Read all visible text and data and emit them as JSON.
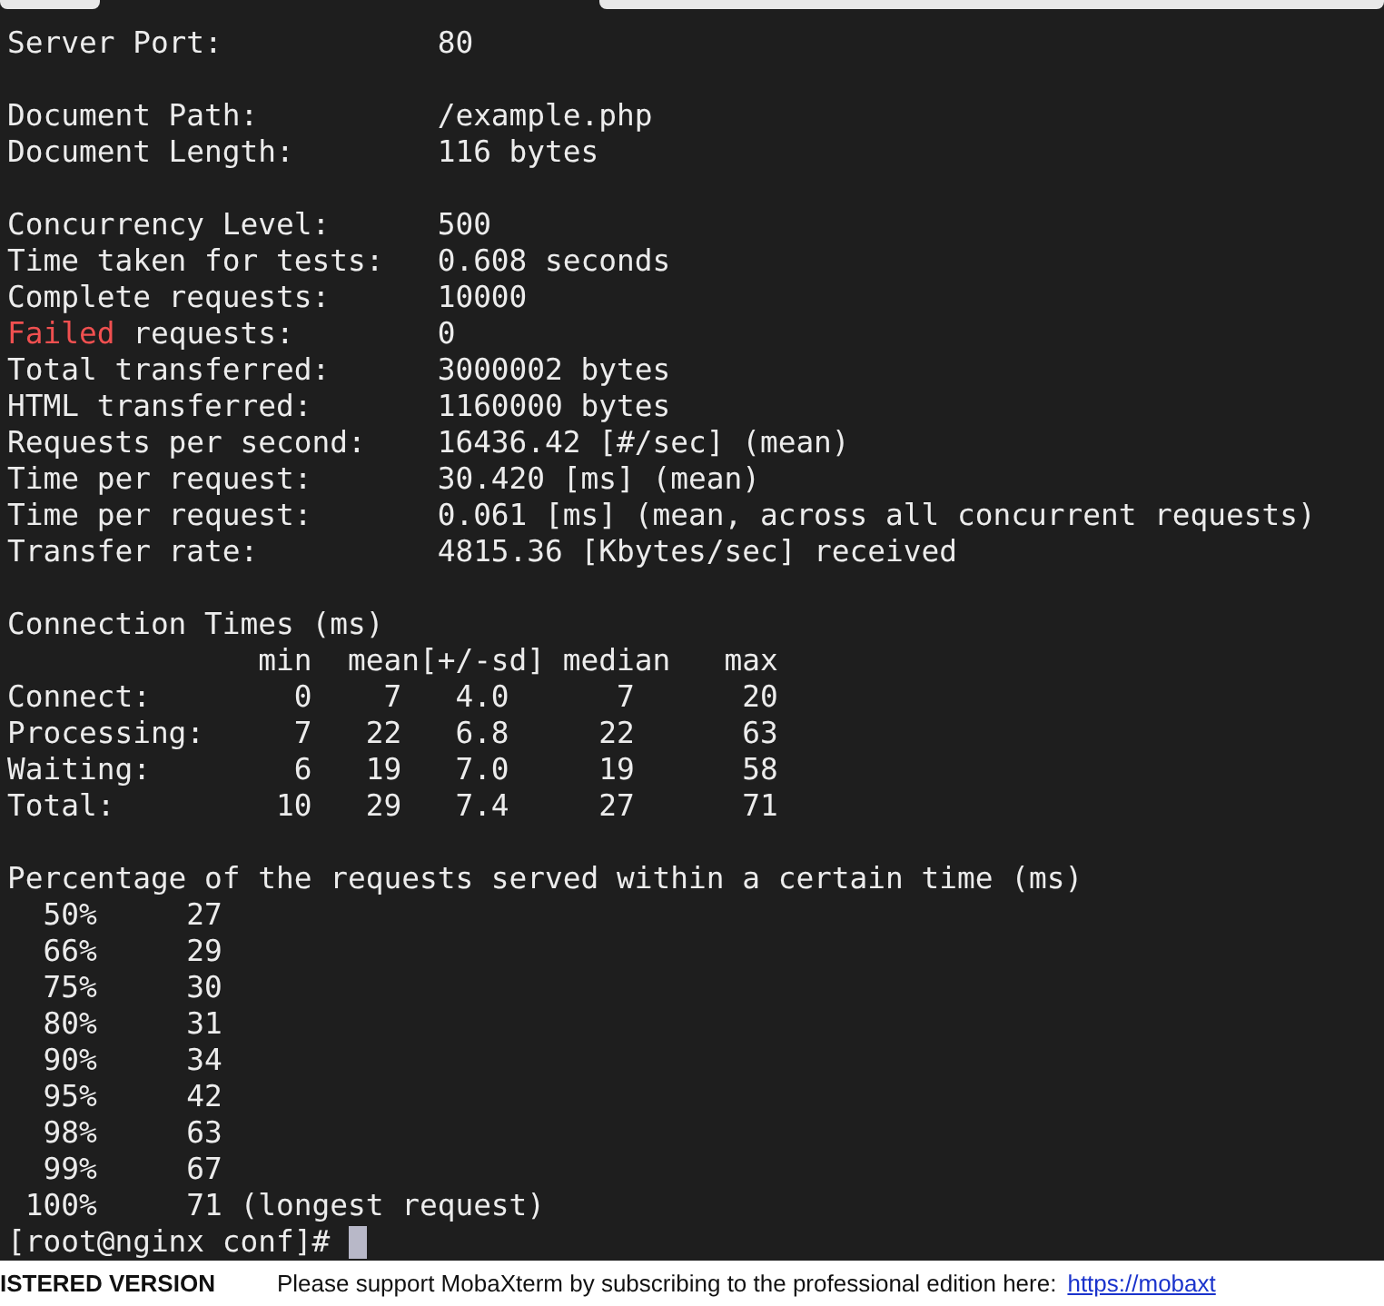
{
  "tabs": [
    {
      "selected": false
    },
    {
      "selected": false
    }
  ],
  "terminal": {
    "lines": [
      {
        "kind": "text",
        "segments": [
          {
            "text": "Server Port:            80"
          }
        ]
      },
      {
        "kind": "blank"
      },
      {
        "kind": "text",
        "segments": [
          {
            "text": "Document Path:          /example.php"
          }
        ]
      },
      {
        "kind": "text",
        "segments": [
          {
            "text": "Document Length:        116 bytes"
          }
        ]
      },
      {
        "kind": "blank"
      },
      {
        "kind": "text",
        "segments": [
          {
            "text": "Concurrency Level:      500"
          }
        ]
      },
      {
        "kind": "text",
        "segments": [
          {
            "text": "Time taken for tests:   0.608 seconds"
          }
        ]
      },
      {
        "kind": "text",
        "segments": [
          {
            "text": "Complete requests:      10000"
          }
        ]
      },
      {
        "kind": "text",
        "segments": [
          {
            "text": "Failed",
            "kind": "error"
          },
          {
            "text": " requests:        0"
          }
        ]
      },
      {
        "kind": "text",
        "segments": [
          {
            "text": "Total transferred:      3000002 bytes"
          }
        ]
      },
      {
        "kind": "text",
        "segments": [
          {
            "text": "HTML transferred:       1160000 bytes"
          }
        ]
      },
      {
        "kind": "text",
        "segments": [
          {
            "text": "Requests per second:    16436.42 [#/sec] (mean)"
          }
        ]
      },
      {
        "kind": "text",
        "segments": [
          {
            "text": "Time per request:       30.420 [ms] (mean)"
          }
        ]
      },
      {
        "kind": "text",
        "segments": [
          {
            "text": "Time per request:       0.061 [ms] (mean, across all concurrent requests)"
          }
        ]
      },
      {
        "kind": "text",
        "segments": [
          {
            "text": "Transfer rate:          4815.36 [Kbytes/sec] received"
          }
        ]
      },
      {
        "kind": "blank"
      },
      {
        "kind": "text",
        "segments": [
          {
            "text": "Connection Times (ms)"
          }
        ]
      },
      {
        "kind": "text",
        "segments": [
          {
            "text": "              min  mean[+/-sd] median   max"
          }
        ]
      },
      {
        "kind": "text",
        "segments": [
          {
            "text": "Connect:        0    7   4.0      7      20"
          }
        ]
      },
      {
        "kind": "text",
        "segments": [
          {
            "text": "Processing:     7   22   6.8     22      63"
          }
        ]
      },
      {
        "kind": "text",
        "segments": [
          {
            "text": "Waiting:        6   19   7.0     19      58"
          }
        ]
      },
      {
        "kind": "text",
        "segments": [
          {
            "text": "Total:         10   29   7.4     27      71"
          }
        ]
      },
      {
        "kind": "blank"
      },
      {
        "kind": "text",
        "segments": [
          {
            "text": "Percentage of the requests served within a certain time (ms)"
          }
        ]
      },
      {
        "kind": "text",
        "segments": [
          {
            "text": "  50%     27"
          }
        ]
      },
      {
        "kind": "text",
        "segments": [
          {
            "text": "  66%     29"
          }
        ]
      },
      {
        "kind": "text",
        "segments": [
          {
            "text": "  75%     30"
          }
        ]
      },
      {
        "kind": "text",
        "segments": [
          {
            "text": "  80%     31"
          }
        ]
      },
      {
        "kind": "text",
        "segments": [
          {
            "text": "  90%     34"
          }
        ]
      },
      {
        "kind": "text",
        "segments": [
          {
            "text": "  95%     42"
          }
        ]
      },
      {
        "kind": "text",
        "segments": [
          {
            "text": "  98%     63"
          }
        ]
      },
      {
        "kind": "text",
        "segments": [
          {
            "text": "  99%     67"
          }
        ]
      },
      {
        "kind": "text",
        "segments": [
          {
            "text": " 100%     71 (longest request)"
          }
        ]
      }
    ],
    "prompt": "[root@nginx conf]#"
  },
  "status_bar": {
    "edition": "ISTERED VERSION",
    "message": "Please support MobaXterm by subscribing to the professional edition here:",
    "link": "https://mobaxt"
  }
}
